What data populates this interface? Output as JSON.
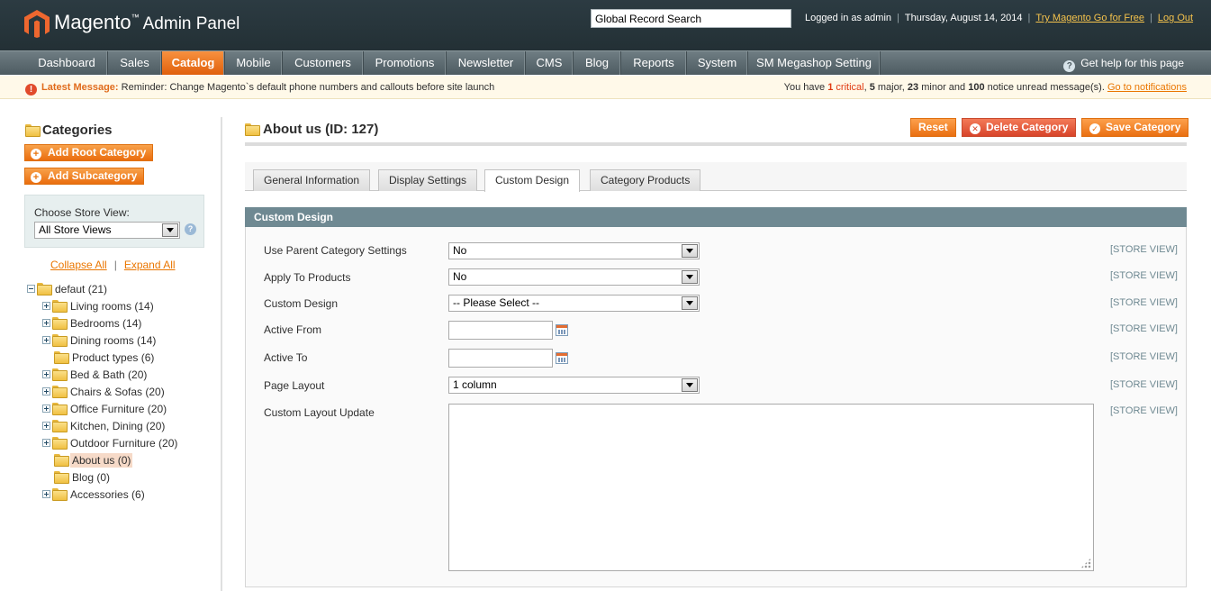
{
  "header": {
    "brand_main": "Magento",
    "brand_tm": "™",
    "brand_sub": "Admin Panel",
    "search_value": "Global Record Search",
    "logged_in": "Logged in as admin",
    "date": "Thursday, August 14, 2014",
    "try_link": "Try Magento Go for Free",
    "logout": "Log Out"
  },
  "nav": {
    "items": [
      "Dashboard",
      "Sales",
      "Catalog",
      "Mobile",
      "Customers",
      "Promotions",
      "Newsletter",
      "CMS",
      "Blog",
      "Reports",
      "System",
      "SM Megashop Setting"
    ],
    "active": "Catalog",
    "help": "Get help for this page"
  },
  "message": {
    "label": "Latest Message:",
    "text": "Reminder: Change Magento`s default phone numbers and callouts before site launch",
    "summary_prefix": "You have",
    "critical_count": "1",
    "critical_label": "critical",
    "major_count": "5",
    "major_label": "major,",
    "minor_count": "23",
    "minor_label": "minor and",
    "notice_count": "100",
    "notice_label": "notice unread message(s).",
    "link": "Go to notifications"
  },
  "sidebar": {
    "title": "Categories",
    "add_root": "Add Root Category",
    "add_sub": "Add Subcategory",
    "store_label": "Choose Store View:",
    "store_value": "All Store Views",
    "collapse_all": "Collapse All",
    "expand_all": "Expand All",
    "tree": [
      {
        "label": "defaut (21)",
        "level": 0,
        "expander": "minus"
      },
      {
        "label": "Living rooms (14)",
        "level": 1,
        "expander": "plus"
      },
      {
        "label": "Bedrooms (14)",
        "level": 1,
        "expander": "plus"
      },
      {
        "label": "Dining rooms (14)",
        "level": 1,
        "expander": "plus"
      },
      {
        "label": "Product types (6)",
        "level": 1,
        "expander": "none"
      },
      {
        "label": "Bed & Bath (20)",
        "level": 1,
        "expander": "plus"
      },
      {
        "label": "Chairs & Sofas (20)",
        "level": 1,
        "expander": "plus"
      },
      {
        "label": "Office Furniture (20)",
        "level": 1,
        "expander": "plus"
      },
      {
        "label": "Kitchen, Dining (20)",
        "level": 1,
        "expander": "plus"
      },
      {
        "label": "Outdoor Furniture (20)",
        "level": 1,
        "expander": "plus"
      },
      {
        "label": "About us (0)",
        "level": 1,
        "expander": "none",
        "selected": true
      },
      {
        "label": "Blog (0)",
        "level": 1,
        "expander": "none"
      },
      {
        "label": "Accessories (6)",
        "level": 1,
        "expander": "plus"
      }
    ]
  },
  "main": {
    "title": "About us (ID: 127)",
    "reset": "Reset",
    "delete": "Delete Category",
    "save": "Save Category",
    "tabs": [
      "General Information",
      "Display Settings",
      "Custom Design",
      "Category Products"
    ],
    "active_tab": "Custom Design",
    "section_title": "Custom Design",
    "scope_label": "[STORE VIEW]",
    "fields": {
      "use_parent": {
        "label": "Use Parent Category Settings",
        "value": "No"
      },
      "apply_products": {
        "label": "Apply To Products",
        "value": "No"
      },
      "custom_design": {
        "label": "Custom Design",
        "value": "-- Please Select --"
      },
      "active_from": {
        "label": "Active From",
        "value": ""
      },
      "active_to": {
        "label": "Active To",
        "value": ""
      },
      "page_layout": {
        "label": "Page Layout",
        "value": "1 column"
      },
      "layout_update": {
        "label": "Custom Layout Update",
        "value": ""
      }
    }
  },
  "colors": {
    "accent_orange": "#ea6f11",
    "header_bg": "#2c3b42",
    "nav_bg": "#5e6c72",
    "section_head": "#6f8992",
    "delete_red": "#d8442a"
  }
}
